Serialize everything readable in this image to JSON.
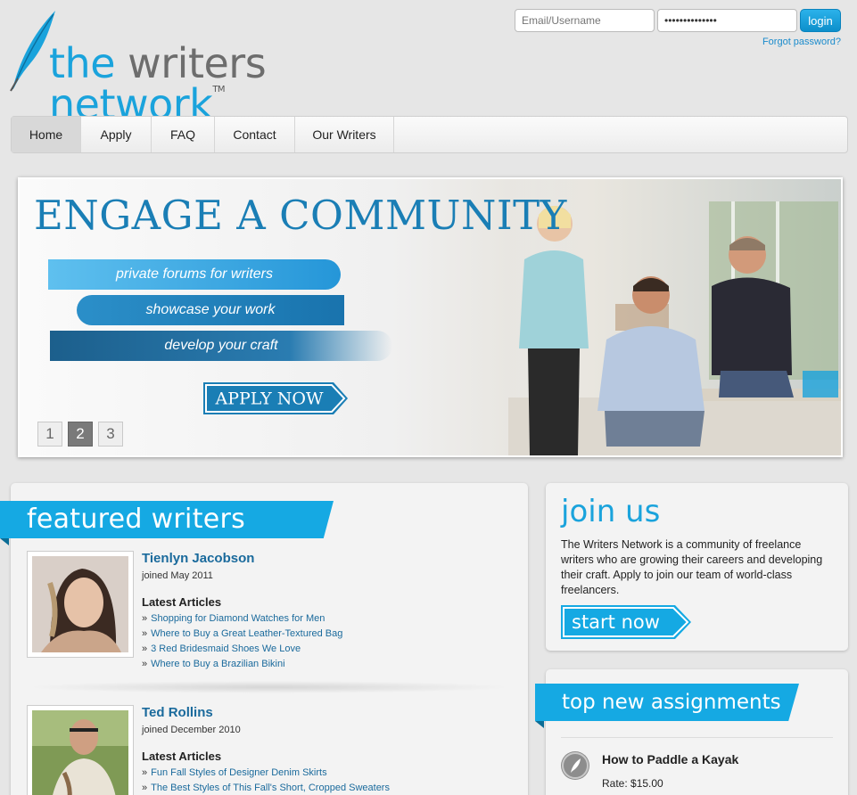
{
  "header": {
    "logo": {
      "part1": "the ",
      "part2": "writers ",
      "part3": "network",
      "tm": "TM"
    },
    "login": {
      "username_placeholder": "Email/Username",
      "password_value": "••••••••••••••",
      "login_label": "login",
      "forgot_label": "Forgot password?"
    }
  },
  "nav": {
    "items": [
      {
        "label": "Home",
        "active": true
      },
      {
        "label": "Apply"
      },
      {
        "label": "FAQ"
      },
      {
        "label": "Contact"
      },
      {
        "label": "Our Writers"
      }
    ]
  },
  "hero": {
    "headline": "ENGAGE A COMMUNITY",
    "ribbons": [
      "private forums for writers",
      "showcase your work",
      "develop your craft"
    ],
    "cta": "APPLY NOW",
    "pager": [
      "1",
      "2",
      "3"
    ],
    "active_page": "2"
  },
  "featured": {
    "title": "featured writers",
    "writers": [
      {
        "name": "Tienlyn Jacobson",
        "joined": "joined May 2011",
        "latest_label": "Latest Articles",
        "articles": [
          "Shopping for Diamond Watches for Men",
          "Where to Buy a Great Leather-Textured Bag",
          "3 Red Bridesmaid Shoes We Love",
          "Where to Buy a Brazilian Bikini"
        ]
      },
      {
        "name": "Ted Rollins",
        "joined": "joined December 2010",
        "latest_label": "Latest Articles",
        "articles": [
          "Fun Fall Styles of Designer Denim Skirts",
          "The Best Styles of This Fall's Short, Cropped Sweaters"
        ]
      }
    ]
  },
  "join": {
    "title": "join us",
    "text": "The Writers Network is a community of freelance writers who are growing their careers and developing their craft. Apply to join our team of world-class freelancers.",
    "cta": "start now"
  },
  "assignments": {
    "title": "top new assignments",
    "items": [
      {
        "title": "How to Paddle a Kayak",
        "rate": "Rate: $15.00"
      }
    ]
  },
  "colors": {
    "accent": "#1aa3dc",
    "link": "#1a6a9c",
    "hero_blue": "#1a7eb5"
  }
}
